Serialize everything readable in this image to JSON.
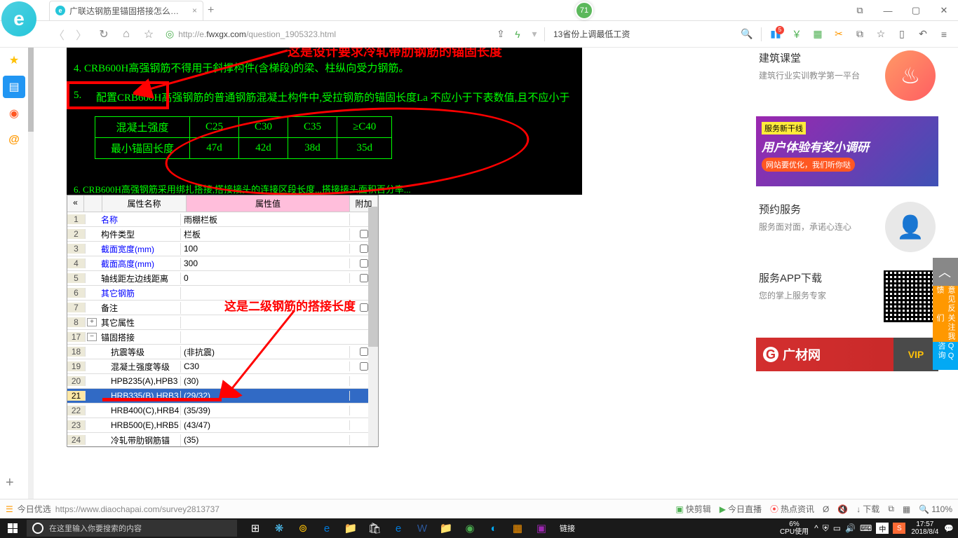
{
  "titlebar": {
    "tab_title": "广联达钢筋里锚固搭接怎么看，好",
    "badge": "71"
  },
  "addrbar": {
    "url_grey_prefix": "http://e.",
    "url_dark": "fwxgx.com",
    "url_grey_suffix": "/question_1905323.html",
    "promo": "13省份上调最低工资"
  },
  "cad": {
    "anno_top": "这是设计要求冷轧带肋钢筋的锚固长度",
    "line4": "4. CRB600H高强钢筋不得用于斜撑构件(含梯段)的梁、柱纵向受力钢筋。",
    "line5": "配置CRB600H高强钢筋的普通钢筋混凝土构件中,受拉钢筋的锚固长度La 不应小于下表数值,且不应小于",
    "line5_pre": "5.",
    "table": {
      "h1": "混凝土强度",
      "h2": "C25",
      "h3": "C30",
      "h4": "C35",
      "h5": "≥C40",
      "r1": "最小锚固长度",
      "v1": "47d",
      "v2": "42d",
      "v3": "38d",
      "v4": "35d"
    },
    "line6": "6. CRB600H高强钢筋采用绑扎搭接,搭接接头的连接区段长度...搭接接头面积百分率...",
    "anno_mid": "这是二级钢筋的搭接长度"
  },
  "prop": {
    "headers": {
      "name": "属性名称",
      "value": "属性值",
      "extra": "附加"
    },
    "rows": [
      {
        "n": "1",
        "name": "名称",
        "val": "雨棚栏板",
        "blue": true,
        "chk": false
      },
      {
        "n": "2",
        "name": "构件类型",
        "val": "栏板",
        "blue": false,
        "chk": true
      },
      {
        "n": "3",
        "name": "截面宽度(mm)",
        "val": "100",
        "blue": true,
        "chk": true
      },
      {
        "n": "4",
        "name": "截面高度(mm)",
        "val": "300",
        "blue": true,
        "chk": true
      },
      {
        "n": "5",
        "name": "轴线距左边线距离",
        "val": "0",
        "blue": false,
        "chk": true
      },
      {
        "n": "6",
        "name": "其它钢筋",
        "val": "",
        "blue": true,
        "chk": false
      },
      {
        "n": "7",
        "name": "备注",
        "val": "",
        "blue": false,
        "chk": true
      },
      {
        "n": "8",
        "name": "其它属性",
        "val": "",
        "blue": false,
        "chk": false,
        "exp": "+"
      },
      {
        "n": "17",
        "name": "锚固搭接",
        "val": "",
        "blue": false,
        "chk": false,
        "exp": "−"
      },
      {
        "n": "18",
        "name": "抗震等级",
        "val": "(非抗震)",
        "blue": false,
        "chk": true,
        "indent": true
      },
      {
        "n": "19",
        "name": "混凝土强度等级",
        "val": "C30",
        "blue": false,
        "chk": true,
        "indent": true
      },
      {
        "n": "20",
        "name": "HPB235(A),HPB3",
        "val": "(30)",
        "blue": false,
        "chk": false,
        "indent": true
      },
      {
        "n": "21",
        "name": "HRB335(B),HRB3",
        "val": "(29/32)",
        "blue": false,
        "chk": false,
        "indent": true,
        "sel": true
      },
      {
        "n": "22",
        "name": "HRB400(C),HRB4",
        "val": "(35/39)",
        "blue": false,
        "chk": false,
        "indent": true
      },
      {
        "n": "23",
        "name": "HRB500(E),HRB5",
        "val": "(43/47)",
        "blue": false,
        "chk": false,
        "indent": true
      },
      {
        "n": "24",
        "name": "冷轧带肋钢筋锚",
        "val": "(35)",
        "blue": false,
        "chk": false,
        "indent": true
      }
    ]
  },
  "rs": {
    "card1": {
      "title": "建筑课堂",
      "desc": "建筑行业实训教学第一平台"
    },
    "banner": {
      "badge": "服务新干线",
      "title": "用户体验有奖小调研",
      "sub": "网站要优化，我们听你哒"
    },
    "card2": {
      "title": "预约服务",
      "desc": "服务面对面，承诺心连心"
    },
    "card3": {
      "title": "服务APP下载",
      "desc": "您的掌上服务专家"
    },
    "bottom": "广材网"
  },
  "float": {
    "b1": "意见反馈",
    "b2": "关注我们",
    "b3": "QQ咨询"
  },
  "statusbar": {
    "left_label": "今日优选",
    "url": "https://www.diaochapai.com/survey2813737",
    "i1": "快剪辑",
    "i2": "今日直播",
    "i3": "热点资讯",
    "i5": "下载",
    "zoom": "110%"
  },
  "taskbar": {
    "search_placeholder": "在这里输入你要搜索的内容",
    "link_label": "链接",
    "cpu_pct": "6%",
    "cpu_label": "CPU使用",
    "ime1": "中",
    "ime2": "S",
    "time": "17:57",
    "date": "2018/8/4"
  }
}
